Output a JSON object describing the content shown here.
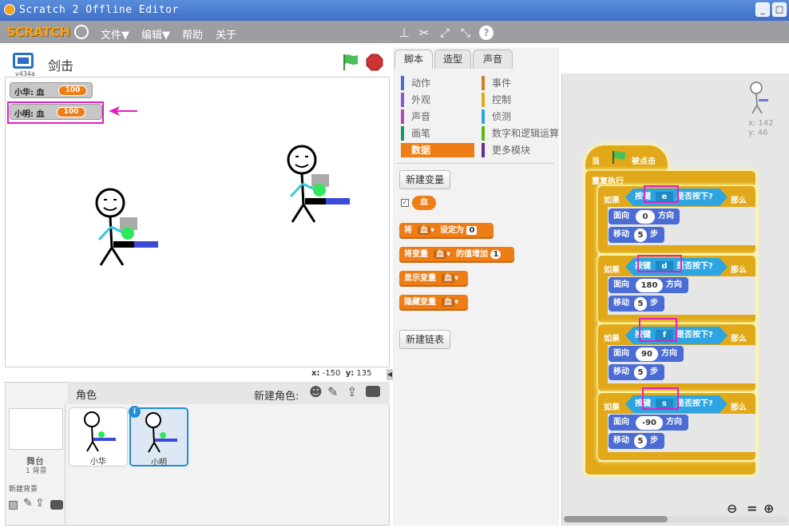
{
  "window": {
    "title": "Scratch 2 Offline Editor"
  },
  "menu": {
    "logo": "SCRATCH",
    "file": "文件▼",
    "edit": "编辑▼",
    "help": "帮助",
    "about": "关于"
  },
  "stage": {
    "project_name": "剑击",
    "version": "v434a",
    "variables": [
      {
        "label": "小华: 血",
        "value": "100"
      },
      {
        "label": "小明: 血",
        "value": "100"
      }
    ],
    "coords": {
      "x_label": "x:",
      "x": "-150",
      "y_label": "y:",
      "y": "135"
    }
  },
  "sprites": {
    "header": "角色",
    "new_sprite_label": "新建角色:",
    "stage_label": "舞台",
    "stage_backdrops": "1 背景",
    "new_backdrop_label": "新建背景",
    "items": [
      {
        "name": "小华"
      },
      {
        "name": "小明"
      }
    ]
  },
  "tabs": [
    "脚本",
    "造型",
    "声音"
  ],
  "categories": {
    "left": [
      {
        "label": "动作",
        "color": "#4a6cd4"
      },
      {
        "label": "外观",
        "color": "#8a55d7"
      },
      {
        "label": "声音",
        "color": "#bb42c3"
      },
      {
        "label": "画笔",
        "color": "#0e9a6c"
      },
      {
        "label": "数据",
        "color": "#ee7d16"
      }
    ],
    "right": [
      {
        "label": "事件",
        "color": "#c88330"
      },
      {
        "label": "控制",
        "color": "#e1a91a"
      },
      {
        "label": "侦测",
        "color": "#2ca5e2"
      },
      {
        "label": "数字和逻辑运算",
        "color": "#5cb712"
      },
      {
        "label": "更多模块",
        "color": "#632d99"
      }
    ]
  },
  "palette": {
    "new_var_button": "新建变量",
    "var_reporter": "血",
    "blocks": [
      {
        "prefix": "将",
        "dropdown": "血",
        "middle": "设定为",
        "input": "0"
      },
      {
        "prefix": "将变量",
        "dropdown": "血",
        "middle": "的值增加",
        "input": "1"
      },
      {
        "prefix": "显示变量",
        "dropdown": "血"
      },
      {
        "prefix": "隐藏变量",
        "dropdown": "血"
      }
    ],
    "new_list_button": "新建链表"
  },
  "script": {
    "hat_when": "当",
    "hat_clicked": "被点击",
    "forever": "重复执行",
    "if_label": "如果",
    "key_label": "按键",
    "pressed_label": "是否按下?",
    "then_label": "那么",
    "point_label": "面向",
    "direction_label": "方向",
    "move_label": "移动",
    "steps_label": "步",
    "branches": [
      {
        "key": "e",
        "direction": "0",
        "steps": "5"
      },
      {
        "key": "d",
        "direction": "180",
        "steps": "5"
      },
      {
        "key": "f",
        "direction": "90",
        "steps": "5"
      },
      {
        "key": "s",
        "direction": "-90",
        "steps": "5"
      }
    ],
    "sprite_x": "x: 142",
    "sprite_y": "y: 46"
  },
  "colors": {
    "accent": "#ee7d16",
    "highlight": "#e020c0",
    "flag": "#4cbf56",
    "stop": "#cc3333"
  }
}
